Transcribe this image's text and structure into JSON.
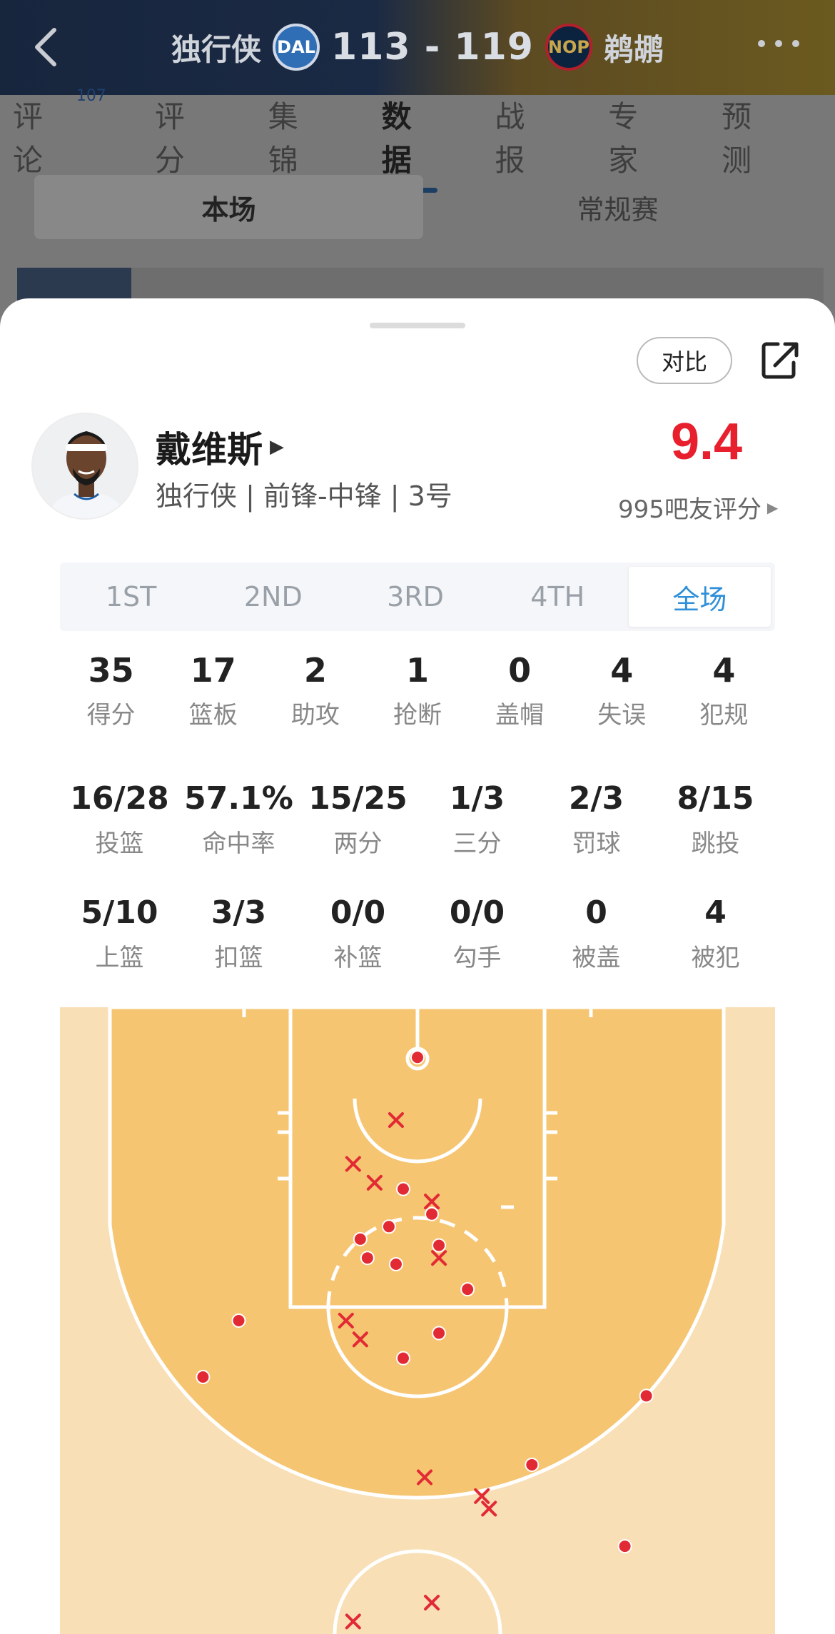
{
  "header": {
    "home_team": "独行侠",
    "home_abbr": "DAL",
    "score": "113 - 119",
    "away_abbr": "NOP",
    "away_team": "鹈鹕"
  },
  "tabs": [
    {
      "label": "评论",
      "badge": "107"
    },
    {
      "label": "评分"
    },
    {
      "label": "集锦"
    },
    {
      "label": "数据"
    },
    {
      "label": "战报"
    },
    {
      "label": "专家"
    },
    {
      "label": "预测"
    }
  ],
  "segments": [
    "本场",
    "常规赛"
  ],
  "sheet": {
    "compare_label": "对比",
    "player": {
      "name": "戴维斯",
      "subtitle": "独行侠 | 前锋-中锋 | 3号",
      "rating": "9.4",
      "rating_count": "995吧友评分"
    },
    "periods": [
      "1ST",
      "2ND",
      "3RD",
      "4TH",
      "全场"
    ],
    "active_period": "全场",
    "main_stats": [
      {
        "value": "35",
        "label": "得分"
      },
      {
        "value": "17",
        "label": "篮板"
      },
      {
        "value": "2",
        "label": "助攻"
      },
      {
        "value": "1",
        "label": "抢断"
      },
      {
        "value": "0",
        "label": "盖帽"
      },
      {
        "value": "4",
        "label": "失误"
      },
      {
        "value": "4",
        "label": "犯规"
      }
    ],
    "shot_stats": [
      {
        "value": "16/28",
        "label": "投篮"
      },
      {
        "value": "57.1%",
        "label": "命中率"
      },
      {
        "value": "15/25",
        "label": "两分"
      },
      {
        "value": "1/3",
        "label": "三分"
      },
      {
        "value": "2/3",
        "label": "罚球"
      },
      {
        "value": "8/15",
        "label": "跳投"
      }
    ],
    "other_stats": [
      {
        "value": "5/10",
        "label": "上篮"
      },
      {
        "value": "3/3",
        "label": "扣篮"
      },
      {
        "value": "0/0",
        "label": "补篮"
      },
      {
        "value": "0/0",
        "label": "勾手"
      },
      {
        "value": "0",
        "label": "被盖"
      },
      {
        "value": "4",
        "label": "被犯"
      }
    ]
  },
  "colors": {
    "rating": "#e8202e",
    "active_period": "#2f8fd8",
    "court_inner": "#f6c572",
    "court_outer": "#f8dfb6",
    "shot_mark": "#e22a35"
  },
  "shot_chart": {
    "made": [
      [
        0.5,
        0.08
      ],
      [
        0.48,
        0.29
      ],
      [
        0.42,
        0.37
      ],
      [
        0.46,
        0.35
      ],
      [
        0.52,
        0.33
      ],
      [
        0.53,
        0.38
      ],
      [
        0.47,
        0.41
      ],
      [
        0.43,
        0.4
      ],
      [
        0.57,
        0.45
      ],
      [
        0.25,
        0.5
      ],
      [
        0.2,
        0.59
      ],
      [
        0.48,
        0.56
      ],
      [
        0.53,
        0.52
      ],
      [
        0.66,
        0.73
      ],
      [
        0.82,
        0.62
      ],
      [
        0.79,
        0.86
      ]
    ],
    "missed": [
      [
        0.47,
        0.18
      ],
      [
        0.41,
        0.25
      ],
      [
        0.52,
        0.31
      ],
      [
        0.53,
        0.4
      ],
      [
        0.4,
        0.5
      ],
      [
        0.42,
        0.53
      ],
      [
        0.51,
        0.75
      ],
      [
        0.59,
        0.78
      ],
      [
        0.6,
        0.8
      ],
      [
        0.41,
        0.98
      ],
      [
        0.52,
        0.95
      ],
      [
        0.44,
        0.28
      ]
    ]
  }
}
